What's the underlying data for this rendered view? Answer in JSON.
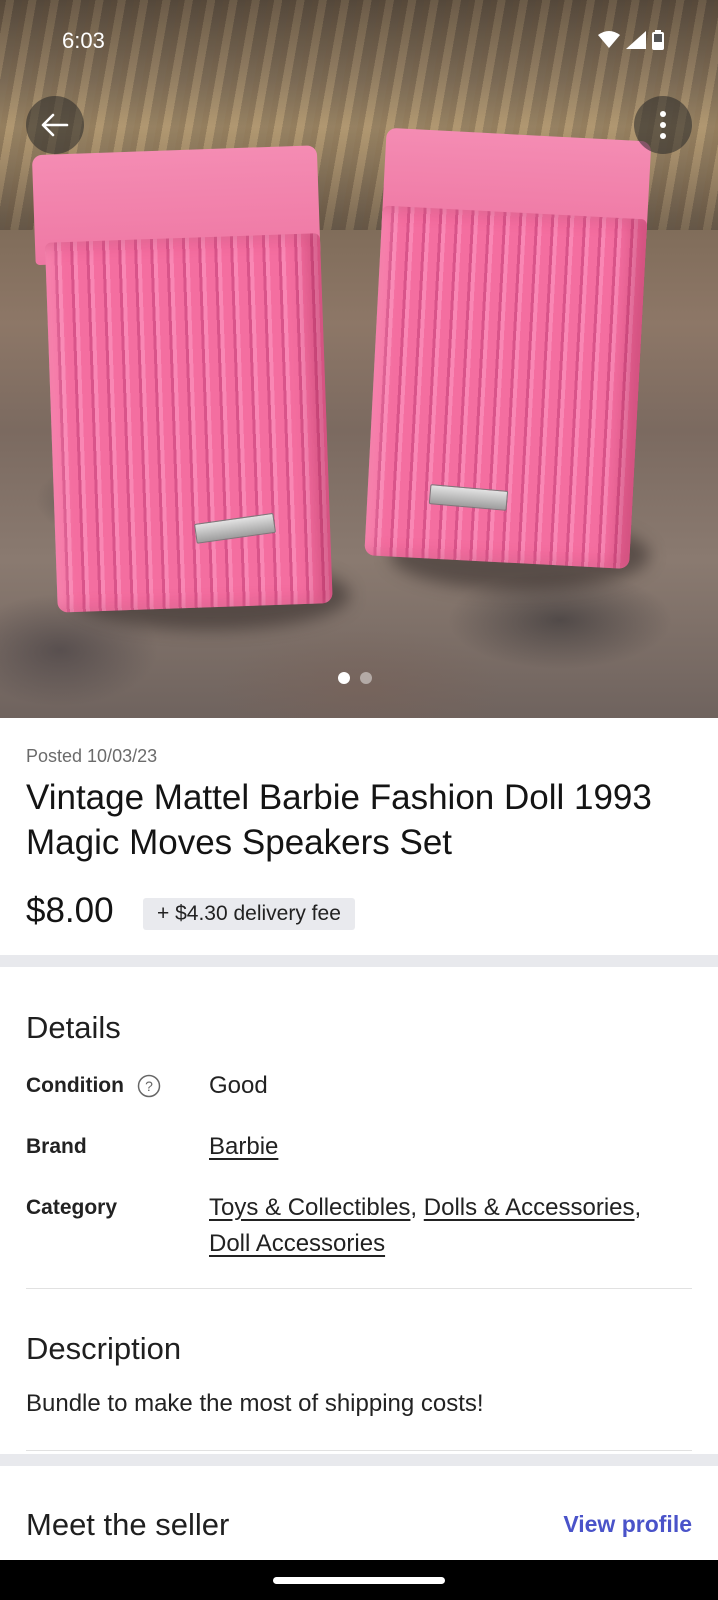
{
  "status_bar": {
    "time": "6:03",
    "icons": [
      "wifi-icon",
      "signal-icon",
      "battery-icon"
    ]
  },
  "top_actions": {
    "back_icon": "arrow-left-icon",
    "more_icon": "more-vertical-icon"
  },
  "carousel": {
    "total_images": 2,
    "active_index": 0
  },
  "listing": {
    "posted": "Posted 10/03/23",
    "title": "Vintage Mattel Barbie Fashion Doll 1993 Magic Moves Speakers Set",
    "price": "$8.00",
    "delivery_fee": "+ $4.30 delivery fee"
  },
  "details": {
    "heading": "Details",
    "condition_label": "Condition",
    "condition_value": "Good",
    "brand_label": "Brand",
    "brand_value": "Barbie",
    "category_label": "Category",
    "categories": [
      "Toys & Collectibles",
      "Dolls & Accessories",
      "Doll Accessories"
    ]
  },
  "description": {
    "heading": "Description",
    "text": "Bundle to make the most of shipping costs!"
  },
  "seller": {
    "heading": "Meet the seller",
    "view_profile": "View profile"
  },
  "colors": {
    "accent": "#4a53c9",
    "divider": "#e8e9ed",
    "fee_chip": "#e9eaee"
  }
}
